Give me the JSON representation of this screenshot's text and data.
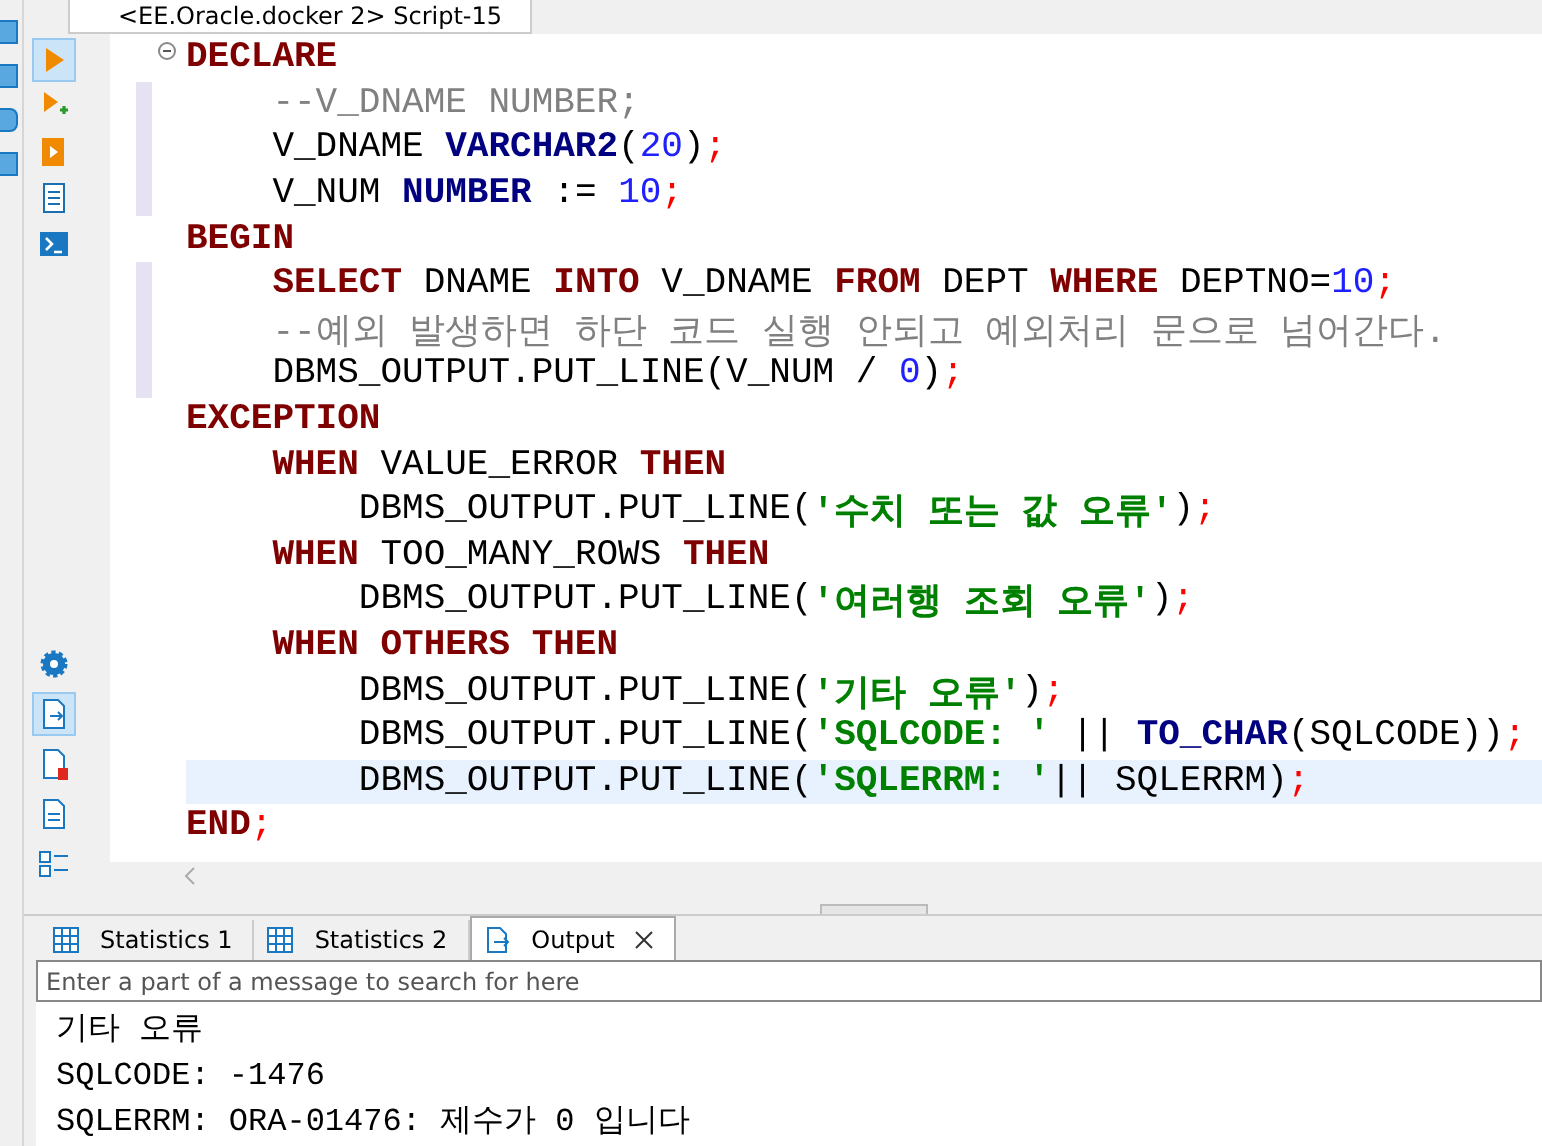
{
  "editor_tab": {
    "title": "<EE.Oracle.docker 2> Script-15"
  },
  "tool_buttons_top": [
    {
      "kind": "run",
      "selected": true
    },
    {
      "kind": "run-new",
      "selected": false
    },
    {
      "kind": "script",
      "selected": false
    },
    {
      "kind": "plan",
      "selected": false
    },
    {
      "kind": "terminal",
      "selected": false
    }
  ],
  "tool_buttons_bottom": [
    {
      "kind": "gear",
      "selected": false
    },
    {
      "kind": "output",
      "selected": true
    },
    {
      "kind": "error",
      "selected": false
    },
    {
      "kind": "params",
      "selected": false
    },
    {
      "kind": "list",
      "selected": false
    }
  ],
  "code": {
    "lines": [
      {
        "changed": false,
        "fold": true,
        "current": false,
        "tokens": [
          {
            "kind": "kw",
            "text": "DECLARE"
          }
        ]
      },
      {
        "changed": true,
        "fold": false,
        "current": false,
        "tokens": [
          {
            "kind": "comment",
            "text": "    --V_DNAME NUMBER;"
          }
        ]
      },
      {
        "changed": true,
        "fold": false,
        "current": false,
        "tokens": [
          {
            "kind": "plain",
            "text": "    V_DNAME "
          },
          {
            "kind": "type",
            "text": "VARCHAR2"
          },
          {
            "kind": "plain",
            "text": "("
          },
          {
            "kind": "num",
            "text": "20"
          },
          {
            "kind": "plain",
            "text": ")"
          },
          {
            "kind": "semi",
            "text": ";"
          }
        ]
      },
      {
        "changed": true,
        "fold": false,
        "current": false,
        "tokens": [
          {
            "kind": "plain",
            "text": "    V_NUM "
          },
          {
            "kind": "type",
            "text": "NUMBER"
          },
          {
            "kind": "plain",
            "text": " := "
          },
          {
            "kind": "num",
            "text": "10"
          },
          {
            "kind": "semi",
            "text": ";"
          }
        ]
      },
      {
        "changed": false,
        "fold": false,
        "current": false,
        "tokens": [
          {
            "kind": "kw",
            "text": "BEGIN"
          }
        ]
      },
      {
        "changed": true,
        "fold": false,
        "current": false,
        "tokens": [
          {
            "kind": "kw",
            "text": "    SELECT"
          },
          {
            "kind": "plain",
            "text": " DNAME "
          },
          {
            "kind": "kw",
            "text": "INTO"
          },
          {
            "kind": "plain",
            "text": " V_DNAME "
          },
          {
            "kind": "kw",
            "text": "FROM"
          },
          {
            "kind": "plain",
            "text": " DEPT "
          },
          {
            "kind": "kw",
            "text": "WHERE"
          },
          {
            "kind": "plain",
            "text": " DEPTNO="
          },
          {
            "kind": "num",
            "text": "10"
          },
          {
            "kind": "semi",
            "text": ";"
          }
        ]
      },
      {
        "changed": true,
        "fold": false,
        "current": false,
        "tokens": [
          {
            "kind": "comment",
            "text": "    --예외 발생하면 하단 코드 실행 안되고 예외처리 문으로 넘어간다."
          }
        ]
      },
      {
        "changed": true,
        "fold": false,
        "current": false,
        "tokens": [
          {
            "kind": "plain",
            "text": "    DBMS_OUTPUT.PUT_LINE(V_NUM / "
          },
          {
            "kind": "num",
            "text": "0"
          },
          {
            "kind": "plain",
            "text": ")"
          },
          {
            "kind": "semi",
            "text": ";"
          }
        ]
      },
      {
        "changed": false,
        "fold": false,
        "current": false,
        "tokens": [
          {
            "kind": "kw",
            "text": "EXCEPTION"
          }
        ]
      },
      {
        "changed": false,
        "fold": false,
        "current": false,
        "tokens": [
          {
            "kind": "kw",
            "text": "    WHEN"
          },
          {
            "kind": "plain",
            "text": " VALUE_ERROR "
          },
          {
            "kind": "kw",
            "text": "THEN"
          }
        ]
      },
      {
        "changed": false,
        "fold": false,
        "current": false,
        "tokens": [
          {
            "kind": "plain",
            "text": "        DBMS_OUTPUT.PUT_LINE("
          },
          {
            "kind": "str",
            "text": "'수치 또는 값 오류'"
          },
          {
            "kind": "plain",
            "text": ")"
          },
          {
            "kind": "semi",
            "text": ";"
          }
        ]
      },
      {
        "changed": false,
        "fold": false,
        "current": false,
        "tokens": [
          {
            "kind": "kw",
            "text": "    WHEN"
          },
          {
            "kind": "plain",
            "text": " TOO_MANY_ROWS "
          },
          {
            "kind": "kw",
            "text": "THEN"
          }
        ]
      },
      {
        "changed": false,
        "fold": false,
        "current": false,
        "tokens": [
          {
            "kind": "plain",
            "text": "        DBMS_OUTPUT.PUT_LINE("
          },
          {
            "kind": "str",
            "text": "'여러행 조회 오류'"
          },
          {
            "kind": "plain",
            "text": ")"
          },
          {
            "kind": "semi",
            "text": ";"
          }
        ]
      },
      {
        "changed": false,
        "fold": false,
        "current": false,
        "tokens": [
          {
            "kind": "kw",
            "text": "    WHEN OTHERS THEN"
          }
        ]
      },
      {
        "changed": false,
        "fold": false,
        "current": false,
        "tokens": [
          {
            "kind": "plain",
            "text": "        DBMS_OUTPUT.PUT_LINE("
          },
          {
            "kind": "str",
            "text": "'기타 오류'"
          },
          {
            "kind": "plain",
            "text": ")"
          },
          {
            "kind": "semi",
            "text": ";"
          }
        ]
      },
      {
        "changed": false,
        "fold": false,
        "current": false,
        "tokens": [
          {
            "kind": "plain",
            "text": "        DBMS_OUTPUT.PUT_LINE("
          },
          {
            "kind": "str",
            "text": "'SQLCODE: '"
          },
          {
            "kind": "plain",
            "text": " || "
          },
          {
            "kind": "type",
            "text": "TO_CHAR"
          },
          {
            "kind": "plain",
            "text": "(SQLCODE))"
          },
          {
            "kind": "semi",
            "text": ";"
          }
        ]
      },
      {
        "changed": false,
        "fold": false,
        "current": true,
        "tokens": [
          {
            "kind": "plain",
            "text": "        DBMS_OUTPUT.PUT_LINE("
          },
          {
            "kind": "str",
            "text": "'SQLERRM: '"
          },
          {
            "kind": "plain",
            "text": "|| SQLERRM)"
          },
          {
            "kind": "semi",
            "text": ";"
          }
        ]
      },
      {
        "changed": false,
        "fold": false,
        "current": false,
        "tokens": [
          {
            "kind": "kw",
            "text": "END"
          },
          {
            "kind": "semi",
            "text": ";"
          }
        ]
      }
    ]
  },
  "result_tabs": [
    {
      "label": "Statistics 1",
      "kind": "grid",
      "selected": false,
      "closable": false
    },
    {
      "label": "Statistics 2",
      "kind": "grid",
      "selected": false,
      "closable": false
    },
    {
      "label": "Output",
      "kind": "output",
      "selected": true,
      "closable": true
    }
  ],
  "output_search": {
    "placeholder": "Enter a part of a message to search for here"
  },
  "output_lines": [
    "기타 오류",
    "SQLCODE: -1476",
    "SQLERRM: ORA-01476: 제수가 0 입니다"
  ]
}
